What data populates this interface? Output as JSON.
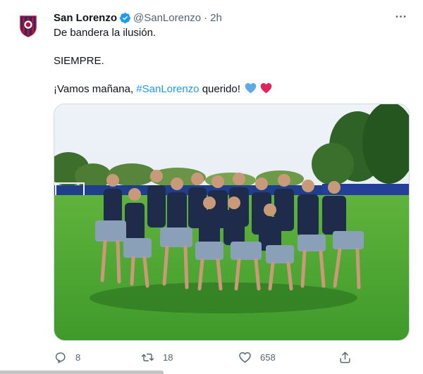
{
  "tweet": {
    "author_name": "San Lorenzo",
    "handle": "@SanLorenzo",
    "separator": "·",
    "time": "2h",
    "verified": true,
    "more_icon": "ellipsis-icon",
    "lines": [
      "De bandera la ilusión.",
      "SIEMPRE.",
      "¡Vamos mañana,"
    ],
    "hashtag": "#SanLorenzo",
    "line3_suffix": "querido!",
    "emoji_hearts": [
      "blue-heart",
      "red-heart"
    ],
    "media_icon": "team-photo"
  },
  "actions": {
    "reply_count": "8",
    "retweet_count": "18",
    "like_count": "658"
  },
  "colors": {
    "accent": "#1d9bf0",
    "text": "#0f1419",
    "secondary": "#536471",
    "heart_blue": "#5da9e9",
    "heart_red": "#e0245e"
  }
}
